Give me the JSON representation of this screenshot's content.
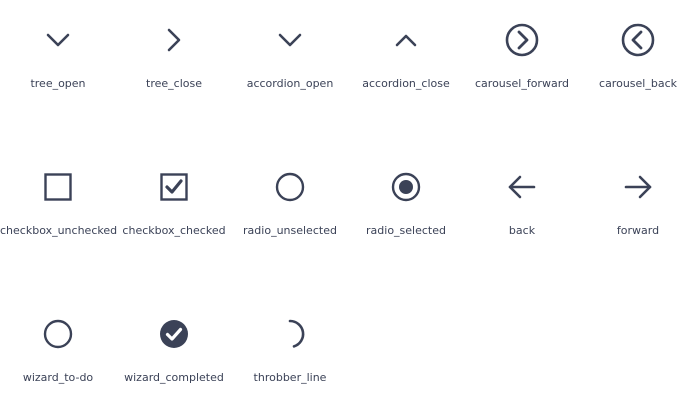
{
  "icon_color": "#3b4257",
  "icons": [
    {
      "label": "tree_open",
      "icon": "chevron-down-icon"
    },
    {
      "label": "tree_close",
      "icon": "chevron-right-icon"
    },
    {
      "label": "accordion_open",
      "icon": "chevron-down-icon"
    },
    {
      "label": "accordion_close",
      "icon": "chevron-up-icon"
    },
    {
      "label": "carousel_forward",
      "icon": "circle-chevron-right-icon"
    },
    {
      "label": "carousel_back",
      "icon": "circle-chevron-left-icon"
    },
    {
      "label": "checkbox_unchecked",
      "icon": "checkbox-unchecked-icon"
    },
    {
      "label": "checkbox_checked",
      "icon": "checkbox-checked-icon"
    },
    {
      "label": "radio_unselected",
      "icon": "radio-unselected-icon"
    },
    {
      "label": "radio_selected",
      "icon": "radio-selected-icon"
    },
    {
      "label": "back",
      "icon": "arrow-left-icon"
    },
    {
      "label": "forward",
      "icon": "arrow-right-icon"
    },
    {
      "label": "wizard_to-do",
      "icon": "circle-outline-icon"
    },
    {
      "label": "wizard_completed",
      "icon": "circle-check-filled-icon"
    },
    {
      "label": "throbber_line",
      "icon": "spinner-arc-icon"
    }
  ]
}
